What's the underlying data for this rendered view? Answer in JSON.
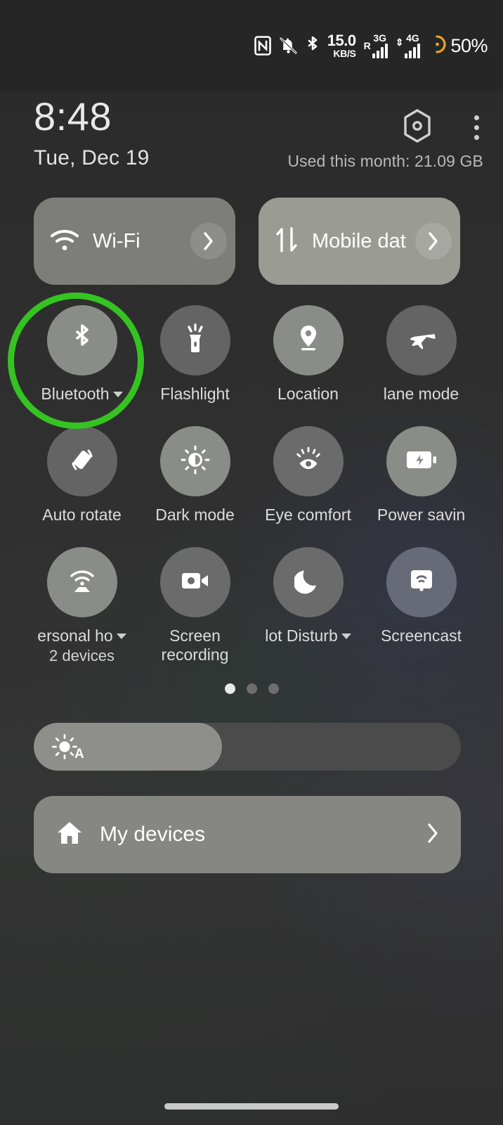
{
  "status_bar": {
    "icons": [
      "nfc-icon",
      "notifications-muted-icon",
      "bluetooth-icon"
    ],
    "network_speed_value": "15.0",
    "network_speed_unit": "KB/S",
    "sim1_roaming": "R",
    "sim1_generation": "3G",
    "sim2_generation": "4G",
    "battery_percent": "50%"
  },
  "header": {
    "time": "8:48",
    "date": "Tue, Dec 19",
    "data_usage": "Used this month: 21.09 GB",
    "settings_icon": "hexagon-gear-icon",
    "menu_icon": "three-dot-menu-icon"
  },
  "big_tiles": [
    {
      "name": "wifi",
      "label": "Wi-Fi",
      "icon": "wifi-icon",
      "state": "on"
    },
    {
      "name": "mobile-data",
      "label": "Mobile dat",
      "icon": "mobile-data-icon",
      "state": "on"
    }
  ],
  "tiles": [
    {
      "name": "bluetooth",
      "label": "Bluetooth",
      "icon": "bluetooth-icon",
      "state": "on",
      "caret": true,
      "sub": ""
    },
    {
      "name": "flashlight",
      "label": "Flashlight",
      "icon": "flashlight-icon",
      "state": "off",
      "caret": false,
      "sub": ""
    },
    {
      "name": "location",
      "label": "Location",
      "icon": "location-pin-icon",
      "state": "on",
      "caret": false,
      "sub": ""
    },
    {
      "name": "airplane-mode",
      "label": "lane mode",
      "icon": "airplane-icon",
      "state": "off",
      "caret": false,
      "sub": ""
    },
    {
      "name": "auto-rotate",
      "label": "Auto rotate",
      "icon": "auto-rotate-icon",
      "state": "off",
      "caret": false,
      "sub": ""
    },
    {
      "name": "dark-mode",
      "label": "Dark mode",
      "icon": "brightness-icon",
      "state": "on",
      "caret": false,
      "sub": ""
    },
    {
      "name": "eye-comfort",
      "label": "Eye comfort",
      "icon": "eye-icon",
      "state": "off2",
      "caret": false,
      "sub": ""
    },
    {
      "name": "power-saving",
      "label": "Power savin",
      "icon": "battery-charge-icon",
      "state": "on",
      "caret": false,
      "sub": ""
    },
    {
      "name": "personal-hotspot",
      "label": "ersonal ho",
      "icon": "hotspot-icon",
      "state": "on",
      "caret": true,
      "sub": "2 devices"
    },
    {
      "name": "screen-recording",
      "label": "Screen recording",
      "icon": "video-camera-icon",
      "state": "off2",
      "caret": false,
      "sub": ""
    },
    {
      "name": "do-not-disturb",
      "label": "lot Disturb",
      "icon": "moon-icon",
      "state": "off2",
      "caret": true,
      "sub": ""
    },
    {
      "name": "screencast",
      "label": "Screencast",
      "icon": "screencast-icon",
      "state": "blue",
      "caret": false,
      "sub": ""
    }
  ],
  "pagination": {
    "total": 3,
    "active_index": 0
  },
  "brightness": {
    "icon": "auto-brightness-icon",
    "auto_label": "A",
    "fill_percent": 44
  },
  "my_devices": {
    "label": "My devices",
    "icon": "home-icon",
    "chevron": "chevron-right-icon"
  },
  "highlight": {
    "target": "bluetooth",
    "color": "#35c322",
    "shape": "circle"
  },
  "colors": {
    "background": "#2b2b2b",
    "tile_on": "#8a8d87",
    "tile_off": "#646464",
    "accent_green": "#35c322",
    "battery_amber": "#e8a427"
  }
}
